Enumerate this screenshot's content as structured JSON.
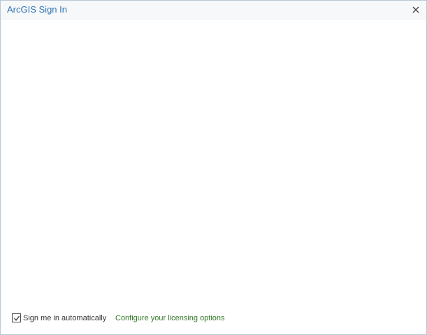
{
  "window": {
    "title": "ArcGIS Sign In",
    "close_icon": "close-icon"
  },
  "footer": {
    "auto_signin": {
      "label": "Sign me in automatically",
      "checked": true,
      "icon": "checkmark-icon"
    },
    "licensing_link": "Configure your licensing options"
  },
  "colors": {
    "title": "#2f74b5",
    "link": "#35772a",
    "titlebar_bg": "#f7f8f9",
    "border": "#b9c7d6"
  }
}
